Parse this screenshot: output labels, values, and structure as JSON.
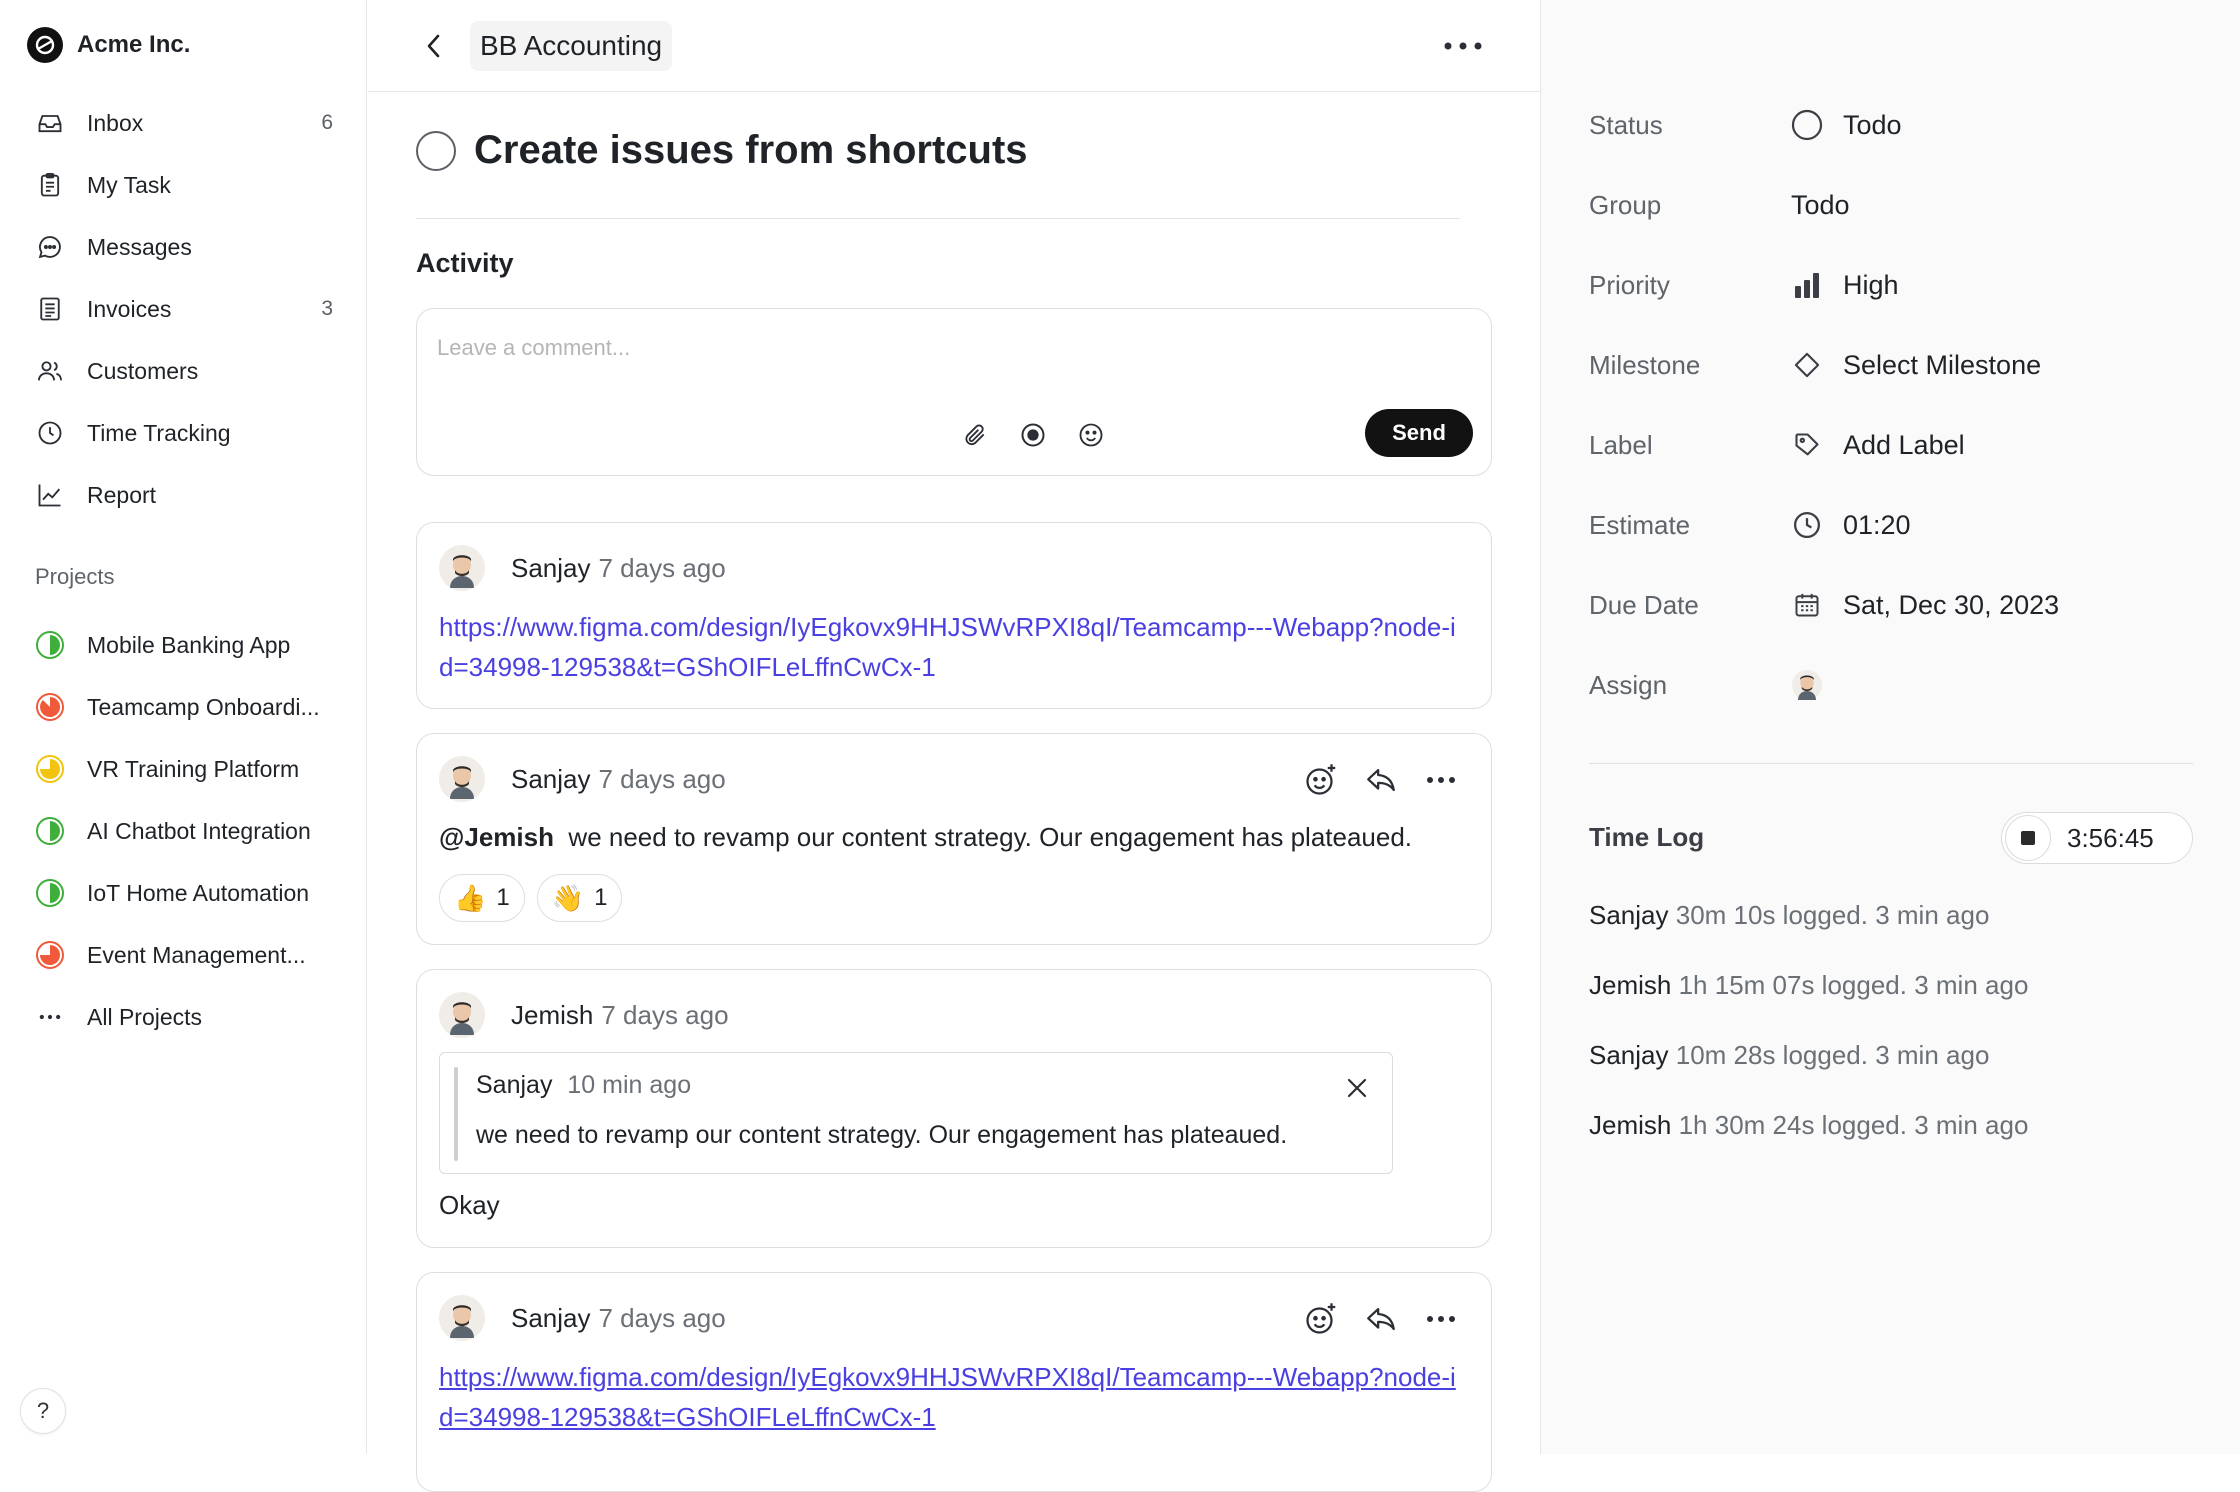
{
  "brand": {
    "name": "Acme Inc."
  },
  "nav": [
    {
      "label": "Inbox",
      "count": "6",
      "icon": "inbox-icon"
    },
    {
      "label": "My Task",
      "count": "",
      "icon": "clipboard-icon"
    },
    {
      "label": "Messages",
      "count": "",
      "icon": "chat-icon"
    },
    {
      "label": "Invoices",
      "count": "3",
      "icon": "invoice-icon"
    },
    {
      "label": "Customers",
      "count": "",
      "icon": "users-icon"
    },
    {
      "label": "Time Tracking",
      "count": "",
      "icon": "clock-icon"
    },
    {
      "label": "Report",
      "count": "",
      "icon": "chart-line-icon"
    }
  ],
  "projects_section": {
    "title": "Projects"
  },
  "projects": [
    {
      "label": "Mobile Banking App",
      "color": "#3fae3b"
    },
    {
      "label": "Teamcamp Onboardi...",
      "color": "#f05a3a"
    },
    {
      "label": "VR Training Platform",
      "color": "#f2c40f"
    },
    {
      "label": "AI Chatbot Integration",
      "color": "#3fae3b"
    },
    {
      "label": "IoT Home Automation",
      "color": "#3fae3b"
    },
    {
      "label": "Event Management...",
      "color": "#f05a3a"
    },
    {
      "label": "All Projects",
      "color": ""
    }
  ],
  "topbar": {
    "breadcrumb": "BB Accounting"
  },
  "issue": {
    "title": "Create issues from shortcuts"
  },
  "activity": {
    "title": "Activity",
    "comment_placeholder": "Leave a comment...",
    "send_label": "Send"
  },
  "comments": [
    {
      "author": "Sanjay",
      "time": "7 days ago",
      "link": "https://www.figma.com/design/IyEgkovx9HHJSWvRPXI8qI/Teamcamp---Webapp?node-id=34998-129538&t=GShOIFLeLffnCwCx-1"
    },
    {
      "author": "Sanjay",
      "time": "7 days ago",
      "mention": "@Jemish",
      "text": "we need to revamp our content strategy. Our engagement has plateaued.",
      "reactions": [
        {
          "emoji": "👍",
          "count": "1"
        },
        {
          "emoji": "👋",
          "count": "1"
        }
      ]
    },
    {
      "author": "Jemish",
      "time": "7 days ago",
      "quote": {
        "author": "Sanjay",
        "time": "10 min ago",
        "text": "we need to revamp our content strategy. Our engagement has plateaued."
      },
      "text": "Okay"
    },
    {
      "author": "Sanjay",
      "time": "7 days ago",
      "link": "https://www.figma.com/design/IyEgkovx9HHJSWvRPXI8qI/Teamcamp---Webapp?node-id=34998-129538&t=GShOIFLeLffnCwCx-1"
    }
  ],
  "properties": {
    "status": {
      "label": "Status",
      "value": "Todo"
    },
    "group": {
      "label": "Group",
      "value": "Todo"
    },
    "priority": {
      "label": "Priority",
      "value": "High"
    },
    "milestone": {
      "label": "Milestone",
      "value": "Select Milestone"
    },
    "label": {
      "label": "Label",
      "value": "Add Label"
    },
    "estimate": {
      "label": "Estimate",
      "value": "01:20"
    },
    "due_date": {
      "label": "Due Date",
      "value": "Sat, Dec 30, 2023"
    },
    "assign": {
      "label": "Assign"
    }
  },
  "time_log": {
    "title": "Time Log",
    "timer": "3:56:45",
    "entries": [
      {
        "who": "Sanjay",
        "text": "30m 10s logged.",
        "when": "3 min ago"
      },
      {
        "who": "Jemish",
        "text": "1h 15m 07s logged.",
        "when": "3 min ago"
      },
      {
        "who": "Sanjay",
        "text": "10m 28s logged.",
        "when": "3 min ago"
      },
      {
        "who": "Jemish",
        "text": "1h 30m 24s logged.",
        "when": "3 min ago"
      }
    ]
  },
  "colors": {
    "link": "#4a3fe0",
    "send_bg": "#121212",
    "panel_bg": "#fafafa"
  }
}
